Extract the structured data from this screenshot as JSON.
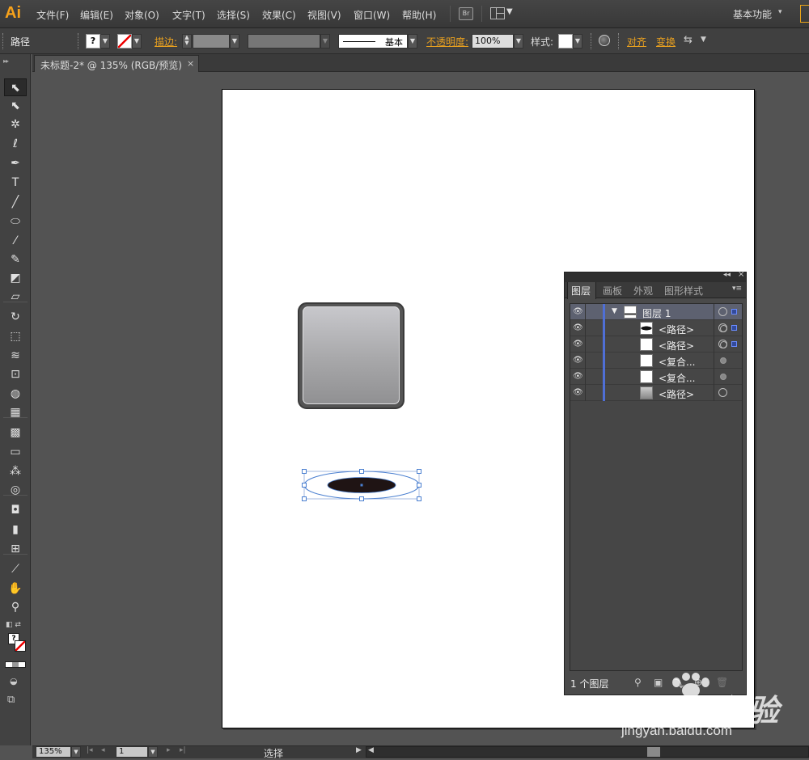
{
  "app": {
    "logo": "Ai",
    "menu": [
      "文件(F)",
      "编辑(E)",
      "对象(O)",
      "文字(T)",
      "选择(S)",
      "效果(C)",
      "视图(V)",
      "窗口(W)",
      "帮助(H)"
    ],
    "bridge_label": "Br",
    "workspace": "基本功能"
  },
  "control": {
    "object_type": "路径",
    "stroke_label": "描边:",
    "stroke_style": "基本",
    "opacity_label": "不透明度:",
    "opacity_value": "100%",
    "style_label": "样式:",
    "align_label": "对齐",
    "transform_label": "变换"
  },
  "document": {
    "tab_title": "未标题-2* @ 135% (RGB/预览)",
    "close": "×"
  },
  "tools": [
    {
      "name": "selection-tool",
      "glyph": "⬉"
    },
    {
      "name": "direct-selection-tool",
      "glyph": "⬉"
    },
    {
      "name": "magic-wand-tool",
      "glyph": "✲"
    },
    {
      "name": "lasso-tool",
      "glyph": "ℓ"
    },
    {
      "name": "pen-tool",
      "glyph": "✒"
    },
    {
      "name": "type-tool",
      "glyph": "T"
    },
    {
      "name": "line-segment-tool",
      "glyph": "╱"
    },
    {
      "name": "ellipse-tool",
      "glyph": "⬭"
    },
    {
      "name": "paintbrush-tool",
      "glyph": "⁄"
    },
    {
      "name": "pencil-tool",
      "glyph": "✎"
    },
    {
      "name": "blob-brush-tool",
      "glyph": "◩"
    },
    {
      "name": "eraser-tool",
      "glyph": "▱"
    },
    {
      "name": "rotate-tool",
      "glyph": "↻"
    },
    {
      "name": "scale-tool",
      "glyph": "⬚"
    },
    {
      "name": "width-tool",
      "glyph": "≋"
    },
    {
      "name": "free-transform-tool",
      "glyph": "⊡"
    },
    {
      "name": "shape-builder-tool",
      "glyph": "◍"
    },
    {
      "name": "perspective-grid-tool",
      "glyph": "▦"
    },
    {
      "name": "mesh-tool",
      "glyph": "▩"
    },
    {
      "name": "gradient-tool",
      "glyph": "▭"
    },
    {
      "name": "eyedropper-tool",
      "glyph": "⁂"
    },
    {
      "name": "blend-tool",
      "glyph": "◎"
    },
    {
      "name": "symbol-sprayer-tool",
      "glyph": "◘"
    },
    {
      "name": "column-graph-tool",
      "glyph": "▮"
    },
    {
      "name": "artboard-tool",
      "glyph": "⊞"
    },
    {
      "name": "slice-tool",
      "glyph": "⟋"
    },
    {
      "name": "hand-tool",
      "glyph": "✋"
    },
    {
      "name": "zoom-tool",
      "glyph": "⚲"
    }
  ],
  "layers_panel": {
    "tabs": [
      "图层",
      "画板",
      "外观",
      "图形样式"
    ],
    "active_tab": "图层",
    "rows": [
      {
        "name": "图层 1",
        "level": "layer"
      },
      {
        "name": "<路径>",
        "level": "item"
      },
      {
        "name": "<路径>",
        "level": "item"
      },
      {
        "name": "<复合...",
        "level": "item"
      },
      {
        "name": "<复合...",
        "level": "item"
      },
      {
        "name": "<路径>",
        "level": "item"
      }
    ],
    "footer_count": "1 个图层"
  },
  "status": {
    "zoom": "135%",
    "page": "1",
    "tool_name": "选择"
  },
  "watermark": {
    "brand": "Bai du 经验",
    "url": "jingyan.baidu.com"
  },
  "colors": {
    "accent": "#f7a21b",
    "layer_color": "#4f6fd6"
  }
}
